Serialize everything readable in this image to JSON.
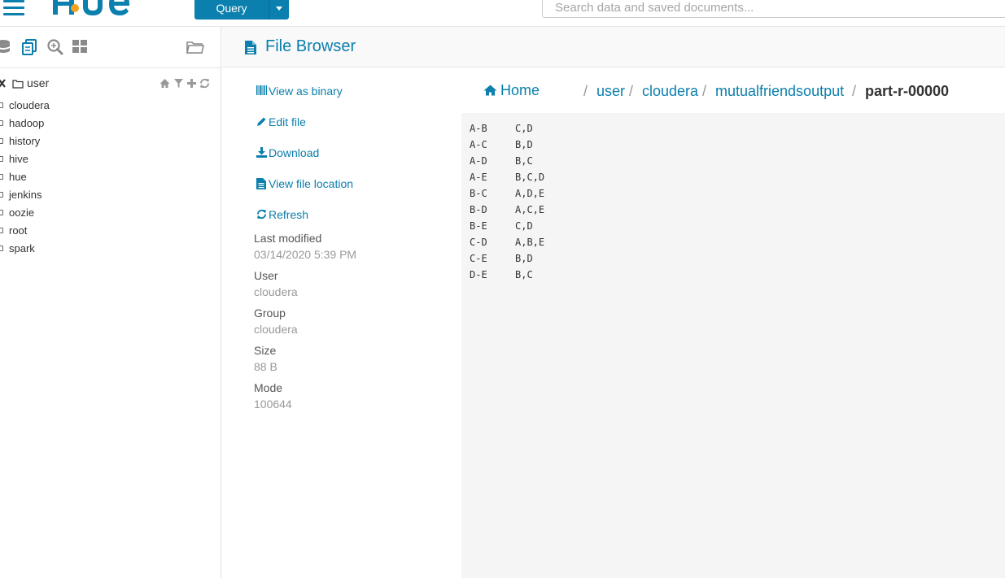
{
  "topbar": {
    "query_label": "Query",
    "search_placeholder": "Search data and saved documents..."
  },
  "assist": {
    "path": "user",
    "folders": [
      "cloudera",
      "hadoop",
      "history",
      "hive",
      "hue",
      "jenkins",
      "oozie",
      "root",
      "spark"
    ]
  },
  "page": {
    "title": "File Browser"
  },
  "actions": {
    "view_binary": "View as binary",
    "edit_file": "Edit file",
    "download": "Download",
    "view_location": "View file location",
    "refresh": "Refresh"
  },
  "meta": {
    "last_modified_label": "Last modified",
    "last_modified": "03/14/2020 5:39 PM",
    "user_label": "User",
    "user": "cloudera",
    "group_label": "Group",
    "group": "cloudera",
    "size_label": "Size",
    "size": "88 B",
    "mode_label": "Mode",
    "mode": "100644"
  },
  "breadcrumb": {
    "home": "Home",
    "items": [
      "user",
      "cloudera",
      "mutualfriendsoutput"
    ],
    "current": "part-r-00000"
  },
  "file": {
    "lines": [
      [
        "A-B",
        "C,D"
      ],
      [
        "A-C",
        "B,D"
      ],
      [
        "A-D",
        "B,C"
      ],
      [
        "A-E",
        "B,C,D"
      ],
      [
        "B-C",
        "A,D,E"
      ],
      [
        "B-D",
        "A,C,E"
      ],
      [
        "B-E",
        "C,D"
      ],
      [
        "C-D",
        "A,B,E"
      ],
      [
        "C-E",
        "B,D"
      ],
      [
        "D-E",
        "B,C"
      ]
    ]
  },
  "colors": {
    "accent": "#0b7fad",
    "muted": "#999999",
    "content_bg": "#f5f5f5"
  }
}
